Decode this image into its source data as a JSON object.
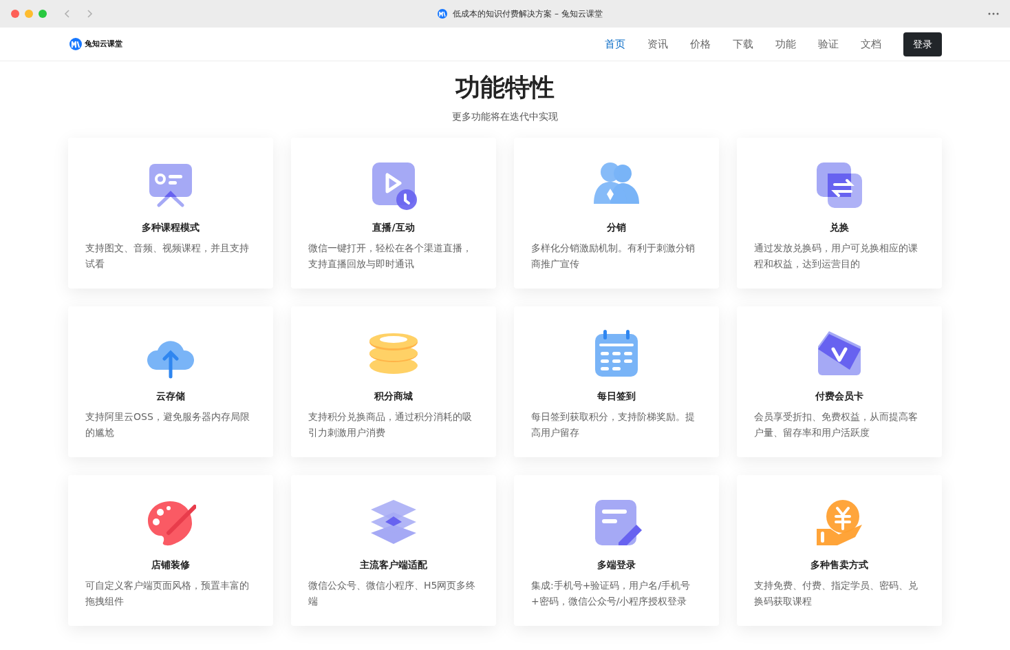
{
  "window": {
    "title": "低成本的知识付费解决方案 – 兔知云课堂"
  },
  "brand": {
    "name": "兔知云课堂"
  },
  "nav": [
    {
      "label": "首页",
      "selected": true
    },
    {
      "label": "资讯",
      "selected": false
    },
    {
      "label": "价格",
      "selected": false
    },
    {
      "label": "下载",
      "selected": false
    },
    {
      "label": "功能",
      "selected": false
    },
    {
      "label": "验证",
      "selected": false
    },
    {
      "label": "文档",
      "selected": false
    }
  ],
  "login_button": "登录",
  "heading": "功能特性",
  "subheading": "更多功能将在迭代中实现",
  "features": [
    {
      "kind": "presentation",
      "title": "多种课程模式",
      "description": "支持图文、音频、视频课程，并且支持试看"
    },
    {
      "kind": "live",
      "title": "直播/互动",
      "description": "微信一键打开，轻松在各个渠道直播，支持直播回放与即时通讯"
    },
    {
      "kind": "users",
      "title": "分销",
      "description": "多样化分销激励机制。有利于刺激分销商推广宣传"
    },
    {
      "kind": "exchange",
      "title": "兑换",
      "description": "通过发放兑换码，用户可兑换相应的课程和权益，达到运营目的"
    },
    {
      "kind": "cloud",
      "title": "云存储",
      "description": "支持阿里云OSS，避免服务器内存局限的尴尬"
    },
    {
      "kind": "coins",
      "title": "积分商城",
      "description": "支持积分兑换商品，通过积分消耗的吸引力刺激用户消费"
    },
    {
      "kind": "calendar",
      "title": "每日签到",
      "description": "每日签到获取积分，支持阶梯奖励。提高用户留存"
    },
    {
      "kind": "vip",
      "title": "付费会员卡",
      "description": "会员享受折扣、免费权益，从而提高客户量、留存率和用户活跃度"
    },
    {
      "kind": "palette",
      "title": "店铺装修",
      "description": "可自定义客户端页面风格，预置丰富的拖拽组件"
    },
    {
      "kind": "layers",
      "title": "主流客户端适配",
      "description": "微信公众号、微信小程序、H5网页多终端"
    },
    {
      "kind": "edit",
      "title": "多端登录",
      "description": "集成:手机号+验证码，用户名/手机号+密码，微信公众号/小程序授权登录"
    },
    {
      "kind": "money",
      "title": "多种售卖方式",
      "description": "支持免费、付费、指定学员、密码、兑换码获取课程"
    }
  ]
}
